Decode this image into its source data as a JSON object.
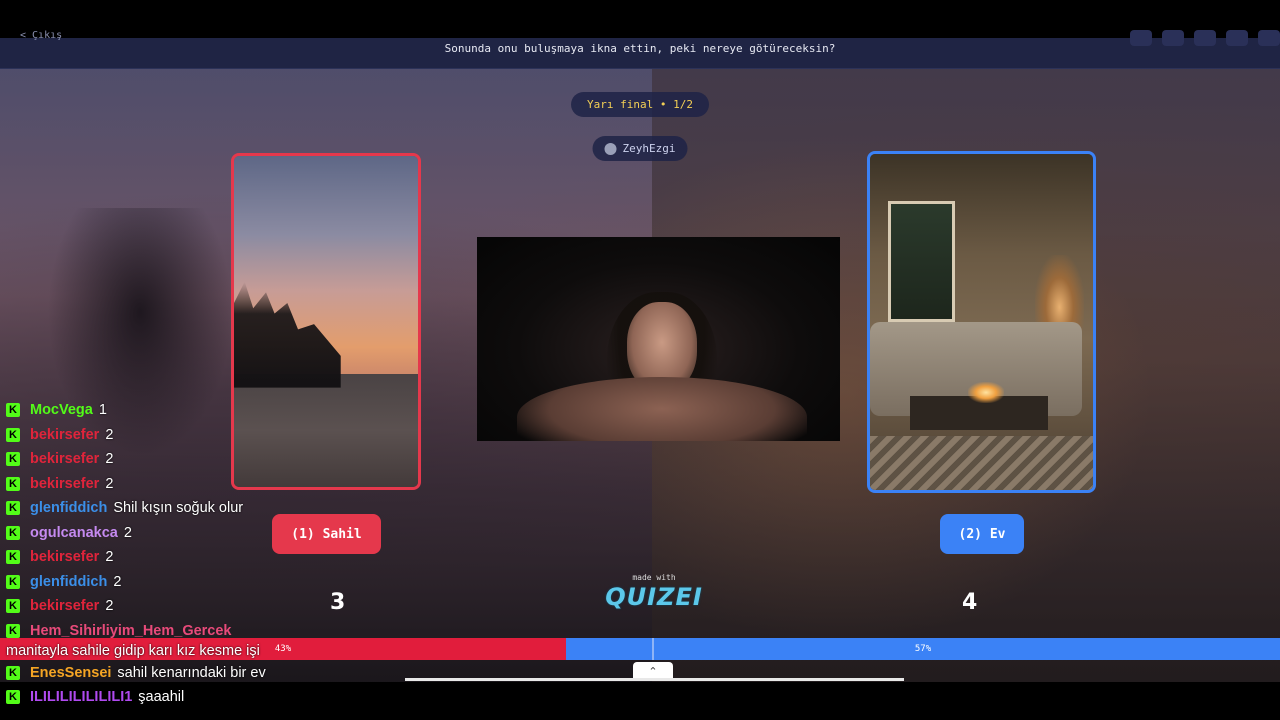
{
  "header": {
    "back_label": "< Çıkış",
    "question": "Sonunda onu buluşmaya ikna ettin, peki nereye götüreceksin?"
  },
  "round": {
    "label": "Yarı final • 1/2"
  },
  "creator": {
    "name": "ZeyhEzgi"
  },
  "choices": [
    {
      "label": "(1) Sahil",
      "votes": "3",
      "percent": "43%",
      "color": "#e5384c"
    },
    {
      "label": "(2) Ev",
      "votes": "4",
      "percent": "57%",
      "color": "#3b82f6"
    }
  ],
  "branding": {
    "made_with": "made with",
    "logo": "QUIZEI"
  },
  "chat": [
    {
      "user": "MocVega",
      "color": "#53fc18",
      "message": "1"
    },
    {
      "user": "bekirsefer",
      "color": "#e0243b",
      "message": "2"
    },
    {
      "user": "bekirsefer",
      "color": "#e0243b",
      "message": "2"
    },
    {
      "user": "bekirsefer",
      "color": "#e0243b",
      "message": "2"
    },
    {
      "user": "glenfiddich",
      "color": "#3b8fe8",
      "message": "Shil kışın soğuk olur"
    },
    {
      "user": "ogulcanakca",
      "color": "#c58af0",
      "message": "2"
    },
    {
      "user": "bekirsefer",
      "color": "#e0243b",
      "message": "2"
    },
    {
      "user": "glenfiddich",
      "color": "#3b8fe8",
      "message": "2"
    },
    {
      "user": "bekirsefer",
      "color": "#e0243b",
      "message": "2"
    },
    {
      "user": "Hem_Sihirliyim_Hem_Gercek",
      "color": "#e84a7a",
      "message": "manitayla sahile gidip karı kız kesme işi"
    },
    {
      "user": "EnesSensei",
      "color": "#f5a524",
      "message": "sahil kenarındaki bir ev"
    },
    {
      "user": "ILILILILILILILI1",
      "color": "#b04af0",
      "message": "şaaahil"
    }
  ]
}
